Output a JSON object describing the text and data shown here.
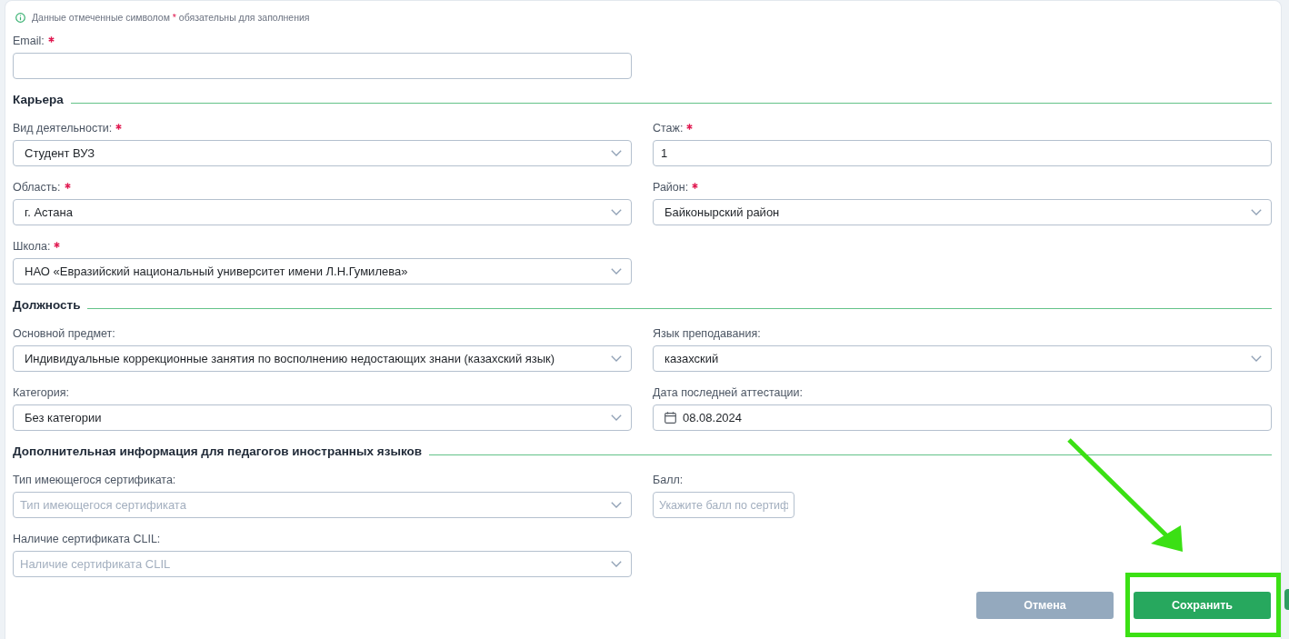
{
  "note": {
    "text_before": "Данные отмеченные символом",
    "marker": "*",
    "text_after": "обязательны для заполнения"
  },
  "top_rows": [
    [
      {
        "kind": "text",
        "label": "Email:",
        "required": true
      }
    ]
  ],
  "sections": [
    {
      "title": "Карьера",
      "rows": [
        [
          {
            "kind": "select",
            "label": "Вид деятельности:",
            "required": true,
            "value": "Студент ВУЗ"
          },
          {
            "kind": "text",
            "label": "Стаж:",
            "required": true,
            "value": "1"
          }
        ],
        [
          {
            "kind": "select",
            "label": "Область:",
            "required": true,
            "value": "г. Астана"
          },
          {
            "kind": "select",
            "label": "Район:",
            "required": true,
            "value": "Байконырский район"
          }
        ],
        [
          {
            "kind": "select",
            "label": "Школа:",
            "required": true,
            "value": "НАО «Евразийский национальный университет имени Л.Н.Гумилева»"
          }
        ]
      ]
    },
    {
      "title": "Должность",
      "rows": [
        [
          {
            "kind": "select",
            "label": "Основной предмет:",
            "required": false,
            "value": "Индивидуальные коррекционные занятия по восполнению недостающих знани (казахский язык)"
          },
          {
            "kind": "select",
            "label": "Язык преподавания:",
            "required": false,
            "value": "казахский"
          }
        ],
        [
          {
            "kind": "select",
            "label": "Категория:",
            "required": false,
            "value": "Без категории"
          },
          {
            "kind": "date",
            "label": "Дата последней аттестации:",
            "required": false,
            "value": "08.08.2024"
          }
        ]
      ]
    },
    {
      "title": "Дополнительная информация для педагогов иностранных языков",
      "rows": [
        [
          {
            "kind": "select",
            "label": "Тип имеющегося сертификата:",
            "required": false,
            "placeholder": "Тип имеющегося сертификата"
          },
          {
            "kind": "score",
            "label": "Балл:",
            "required": false,
            "placeholder": "Укажите балл по сертиф"
          }
        ],
        [
          {
            "kind": "select",
            "label": "Наличие сертификата CLIL:",
            "required": false,
            "placeholder": "Наличие сертификата CLIL"
          }
        ]
      ]
    }
  ],
  "buttons": [
    {
      "label": "Отмена",
      "kind": "secondary"
    },
    {
      "label": "Сохранить",
      "kind": "primary"
    }
  ]
}
